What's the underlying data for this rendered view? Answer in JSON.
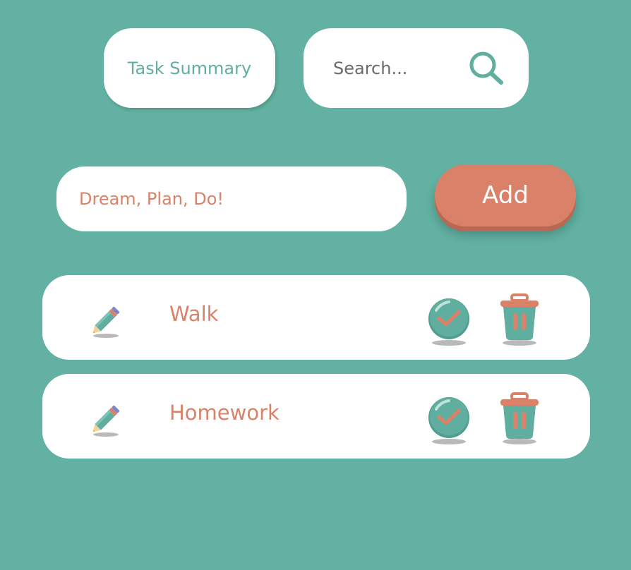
{
  "header": {
    "summary_label": "Task Summary",
    "search_placeholder": "Search..."
  },
  "composer": {
    "input_placeholder": "Dream, Plan, Do!",
    "input_value": "",
    "add_label": "Add"
  },
  "tasks": [
    {
      "label": "Walk"
    },
    {
      "label": "Homework"
    }
  ],
  "icons": {
    "search": "magnifier-icon",
    "edit": "pencil-icon",
    "complete": "checkmark-circle-icon",
    "delete": "trash-icon"
  },
  "colors": {
    "background": "#62b1a2",
    "accent": "#d9826a",
    "teal": "#5fae9f",
    "surface": "#ffffff"
  }
}
